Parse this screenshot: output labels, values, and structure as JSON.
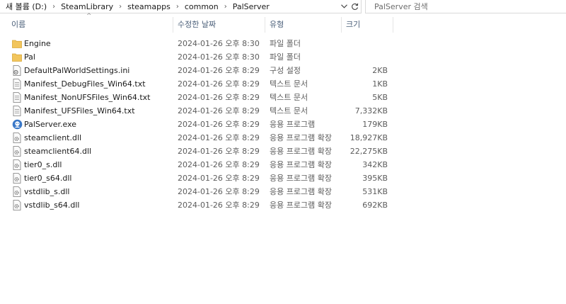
{
  "breadcrumb": {
    "items": [
      "새 볼륨 (D:)",
      "SteamLibrary",
      "steamapps",
      "common",
      "PalServer"
    ]
  },
  "search": {
    "placeholder": "PalServer 검색"
  },
  "columns": {
    "name": "이름",
    "date": "수정한 날짜",
    "type": "유형",
    "size": "크기"
  },
  "files": [
    {
      "name": "Engine",
      "date": "2024-01-26 오후 8:30",
      "type": "파일 폴더",
      "size": "",
      "icon": "folder-icon"
    },
    {
      "name": "Pal",
      "date": "2024-01-26 오후 8:30",
      "type": "파일 폴더",
      "size": "",
      "icon": "folder-icon"
    },
    {
      "name": "DefaultPalWorldSettings.ini",
      "date": "2024-01-26 오후 8:29",
      "type": "구성 설정",
      "size": "2KB",
      "icon": "settings-file-icon"
    },
    {
      "name": "Manifest_DebugFiles_Win64.txt",
      "date": "2024-01-26 오후 8:29",
      "type": "텍스트 문서",
      "size": "1KB",
      "icon": "text-file-icon"
    },
    {
      "name": "Manifest_NonUFSFiles_Win64.txt",
      "date": "2024-01-26 오후 8:29",
      "type": "텍스트 문서",
      "size": "5KB",
      "icon": "text-file-icon"
    },
    {
      "name": "Manifest_UFSFiles_Win64.txt",
      "date": "2024-01-26 오후 8:29",
      "type": "텍스트 문서",
      "size": "7,332KB",
      "icon": "text-file-icon"
    },
    {
      "name": "PalServer.exe",
      "date": "2024-01-26 오후 8:29",
      "type": "응용 프로그램",
      "size": "179KB",
      "icon": "app-icon"
    },
    {
      "name": "steamclient.dll",
      "date": "2024-01-26 오후 8:29",
      "type": "응용 프로그램 확장",
      "size": "18,927KB",
      "icon": "dll-file-icon"
    },
    {
      "name": "steamclient64.dll",
      "date": "2024-01-26 오후 8:29",
      "type": "응용 프로그램 확장",
      "size": "22,275KB",
      "icon": "dll-file-icon"
    },
    {
      "name": "tier0_s.dll",
      "date": "2024-01-26 오후 8:29",
      "type": "응용 프로그램 확장",
      "size": "342KB",
      "icon": "dll-file-icon"
    },
    {
      "name": "tier0_s64.dll",
      "date": "2024-01-26 오후 8:29",
      "type": "응용 프로그램 확장",
      "size": "395KB",
      "icon": "dll-file-icon"
    },
    {
      "name": "vstdlib_s.dll",
      "date": "2024-01-26 오후 8:29",
      "type": "응용 프로그램 확장",
      "size": "531KB",
      "icon": "dll-file-icon"
    },
    {
      "name": "vstdlib_s64.dll",
      "date": "2024-01-26 오후 8:29",
      "type": "응용 프로그램 확장",
      "size": "692KB",
      "icon": "dll-file-icon"
    }
  ],
  "colors": {
    "header_text": "#4c607a",
    "folder": "#f2c55c",
    "app_icon": "#3a78c8"
  }
}
